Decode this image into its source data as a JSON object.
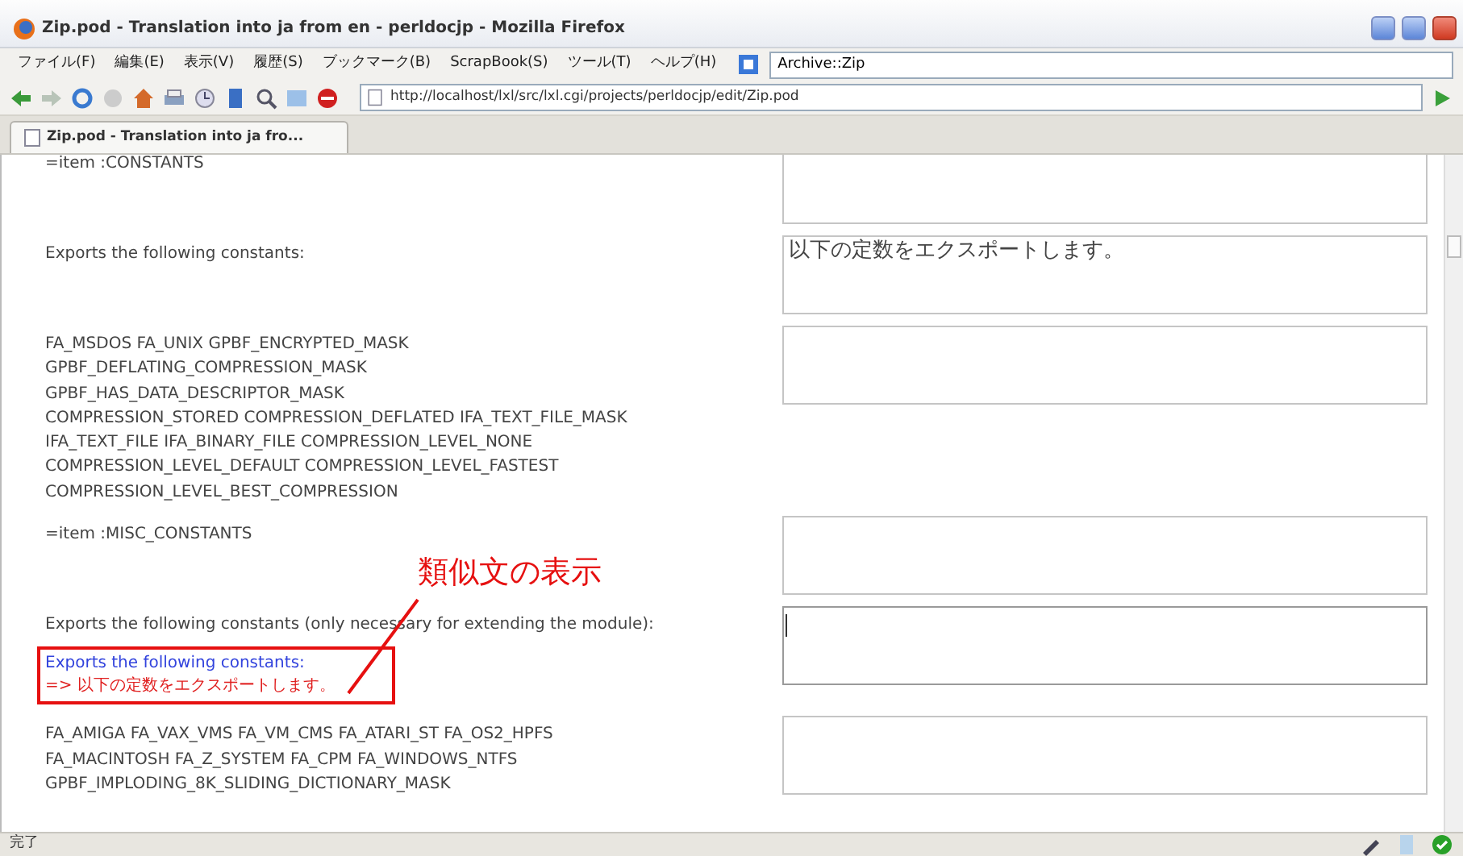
{
  "window": {
    "title": "Zip.pod - Translation into ja from en - perldocjp - Mozilla Firefox"
  },
  "menu": [
    "ファイル(F)",
    "編集(E)",
    "表示(V)",
    "履歴(S)",
    "ブックマーク(B)",
    "ScrapBook(S)",
    "ツール(T)",
    "ヘルプ(H)"
  ],
  "search": {
    "value": "Archive::Zip"
  },
  "address": {
    "value": "http://localhost/lxl/src/lxl.cgi/projects/perldocjp/edit/Zip.pod"
  },
  "tabs": [
    {
      "label": "Zip.pod - Translation into ja fro...",
      "selected": true
    }
  ],
  "rows": [
    {
      "source": "=item :CONSTANTS",
      "translation": "",
      "focused": false
    },
    {
      "source": "Exports the following constants:",
      "translation": "以下の定数をエクスポートします。",
      "focused": false
    },
    {
      "source": "FA_MSDOS FA_UNIX GPBF_ENCRYPTED_MASK\nGPBF_DEFLATING_COMPRESSION_MASK\nGPBF_HAS_DATA_DESCRIPTOR_MASK\nCOMPRESSION_STORED COMPRESSION_DEFLATED IFA_TEXT_FILE_MASK\nIFA_TEXT_FILE IFA_BINARY_FILE COMPRESSION_LEVEL_NONE\nCOMPRESSION_LEVEL_DEFAULT COMPRESSION_LEVEL_FASTEST\nCOMPRESSION_LEVEL_BEST_COMPRESSION",
      "translation": "",
      "focused": false
    },
    {
      "source": "=item :MISC_CONSTANTS",
      "translation": "",
      "focused": false
    },
    {
      "source": "Exports the following constants (only necessary for extending the module):",
      "translation": "",
      "focused": true,
      "suggestion": {
        "source": "Exports the following constants:",
        "arrow": "=>",
        "translation": "以下の定数をエクスポートします。"
      }
    },
    {
      "source": "FA_AMIGA FA_VAX_VMS FA_VM_CMS FA_ATARI_ST FA_OS2_HPFS\nFA_MACINTOSH FA_Z_SYSTEM FA_CPM FA_WINDOWS_NTFS\nGPBF_IMPLODING_8K_SLIDING_DICTIONARY_MASK",
      "translation": "",
      "focused": false
    }
  ],
  "annotation": {
    "text": "類似文の表示"
  },
  "status_bar": {
    "text": "完了"
  }
}
